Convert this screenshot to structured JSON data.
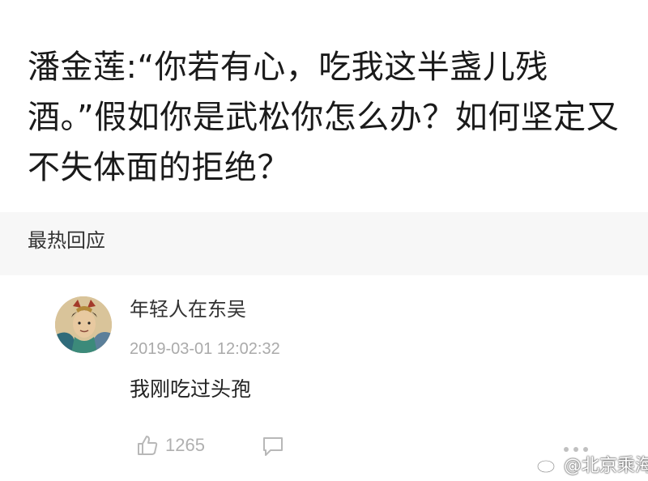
{
  "post": {
    "question": "潘金莲:“你若有心，吃我这半盏儿残酒。”假如你是武松你怎么办？如何坚定又不失体面的拒绝？"
  },
  "section": {
    "title": "最热回应"
  },
  "comment": {
    "username": "年轻人在东吴",
    "timestamp": "2019-03-01 12:02:32",
    "text": "我刚吃过头孢",
    "likes": "1265",
    "icons": {
      "like": "thumbs-up-icon",
      "reply": "comment-bubble-icon",
      "more": "more-dots-icon"
    }
  },
  "watermark": {
    "text": "@北京乘海生",
    "icon": "weibo-logo-icon"
  }
}
